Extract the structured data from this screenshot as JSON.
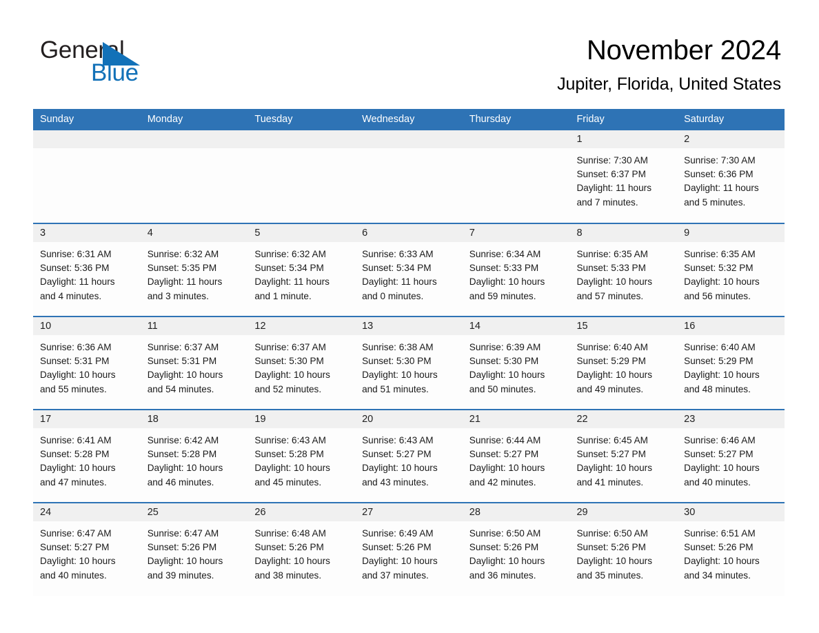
{
  "brand": {
    "name_part1": "General",
    "name_part2": "Blue",
    "logo_icon": "triangle-logo-icon",
    "accent_color": "#1271b8"
  },
  "header": {
    "month_title": "November 2024",
    "location": "Jupiter, Florida, United States"
  },
  "theme": {
    "header_blue": "#2e73b5",
    "daynum_band_gray": "#f0f0f0",
    "cell_background": "#fdfdfd",
    "text_color": "#1a1a1a"
  },
  "weekday_headers": [
    "Sunday",
    "Monday",
    "Tuesday",
    "Wednesday",
    "Thursday",
    "Friday",
    "Saturday"
  ],
  "weeks": [
    [
      {
        "day": "",
        "sunrise": "",
        "sunset": "",
        "daylight_line1": "",
        "daylight_line2": "",
        "empty": true
      },
      {
        "day": "",
        "sunrise": "",
        "sunset": "",
        "daylight_line1": "",
        "daylight_line2": "",
        "empty": true
      },
      {
        "day": "",
        "sunrise": "",
        "sunset": "",
        "daylight_line1": "",
        "daylight_line2": "",
        "empty": true
      },
      {
        "day": "",
        "sunrise": "",
        "sunset": "",
        "daylight_line1": "",
        "daylight_line2": "",
        "empty": true
      },
      {
        "day": "",
        "sunrise": "",
        "sunset": "",
        "daylight_line1": "",
        "daylight_line2": "",
        "empty": true
      },
      {
        "day": "1",
        "sunrise": "Sunrise: 7:30 AM",
        "sunset": "Sunset: 6:37 PM",
        "daylight_line1": "Daylight: 11 hours",
        "daylight_line2": "and 7 minutes."
      },
      {
        "day": "2",
        "sunrise": "Sunrise: 7:30 AM",
        "sunset": "Sunset: 6:36 PM",
        "daylight_line1": "Daylight: 11 hours",
        "daylight_line2": "and 5 minutes."
      }
    ],
    [
      {
        "day": "3",
        "sunrise": "Sunrise: 6:31 AM",
        "sunset": "Sunset: 5:36 PM",
        "daylight_line1": "Daylight: 11 hours",
        "daylight_line2": "and 4 minutes."
      },
      {
        "day": "4",
        "sunrise": "Sunrise: 6:32 AM",
        "sunset": "Sunset: 5:35 PM",
        "daylight_line1": "Daylight: 11 hours",
        "daylight_line2": "and 3 minutes."
      },
      {
        "day": "5",
        "sunrise": "Sunrise: 6:32 AM",
        "sunset": "Sunset: 5:34 PM",
        "daylight_line1": "Daylight: 11 hours",
        "daylight_line2": "and 1 minute."
      },
      {
        "day": "6",
        "sunrise": "Sunrise: 6:33 AM",
        "sunset": "Sunset: 5:34 PM",
        "daylight_line1": "Daylight: 11 hours",
        "daylight_line2": "and 0 minutes."
      },
      {
        "day": "7",
        "sunrise": "Sunrise: 6:34 AM",
        "sunset": "Sunset: 5:33 PM",
        "daylight_line1": "Daylight: 10 hours",
        "daylight_line2": "and 59 minutes."
      },
      {
        "day": "8",
        "sunrise": "Sunrise: 6:35 AM",
        "sunset": "Sunset: 5:33 PM",
        "daylight_line1": "Daylight: 10 hours",
        "daylight_line2": "and 57 minutes."
      },
      {
        "day": "9",
        "sunrise": "Sunrise: 6:35 AM",
        "sunset": "Sunset: 5:32 PM",
        "daylight_line1": "Daylight: 10 hours",
        "daylight_line2": "and 56 minutes."
      }
    ],
    [
      {
        "day": "10",
        "sunrise": "Sunrise: 6:36 AM",
        "sunset": "Sunset: 5:31 PM",
        "daylight_line1": "Daylight: 10 hours",
        "daylight_line2": "and 55 minutes."
      },
      {
        "day": "11",
        "sunrise": "Sunrise: 6:37 AM",
        "sunset": "Sunset: 5:31 PM",
        "daylight_line1": "Daylight: 10 hours",
        "daylight_line2": "and 54 minutes."
      },
      {
        "day": "12",
        "sunrise": "Sunrise: 6:37 AM",
        "sunset": "Sunset: 5:30 PM",
        "daylight_line1": "Daylight: 10 hours",
        "daylight_line2": "and 52 minutes."
      },
      {
        "day": "13",
        "sunrise": "Sunrise: 6:38 AM",
        "sunset": "Sunset: 5:30 PM",
        "daylight_line1": "Daylight: 10 hours",
        "daylight_line2": "and 51 minutes."
      },
      {
        "day": "14",
        "sunrise": "Sunrise: 6:39 AM",
        "sunset": "Sunset: 5:30 PM",
        "daylight_line1": "Daylight: 10 hours",
        "daylight_line2": "and 50 minutes."
      },
      {
        "day": "15",
        "sunrise": "Sunrise: 6:40 AM",
        "sunset": "Sunset: 5:29 PM",
        "daylight_line1": "Daylight: 10 hours",
        "daylight_line2": "and 49 minutes."
      },
      {
        "day": "16",
        "sunrise": "Sunrise: 6:40 AM",
        "sunset": "Sunset: 5:29 PM",
        "daylight_line1": "Daylight: 10 hours",
        "daylight_line2": "and 48 minutes."
      }
    ],
    [
      {
        "day": "17",
        "sunrise": "Sunrise: 6:41 AM",
        "sunset": "Sunset: 5:28 PM",
        "daylight_line1": "Daylight: 10 hours",
        "daylight_line2": "and 47 minutes."
      },
      {
        "day": "18",
        "sunrise": "Sunrise: 6:42 AM",
        "sunset": "Sunset: 5:28 PM",
        "daylight_line1": "Daylight: 10 hours",
        "daylight_line2": "and 46 minutes."
      },
      {
        "day": "19",
        "sunrise": "Sunrise: 6:43 AM",
        "sunset": "Sunset: 5:28 PM",
        "daylight_line1": "Daylight: 10 hours",
        "daylight_line2": "and 45 minutes."
      },
      {
        "day": "20",
        "sunrise": "Sunrise: 6:43 AM",
        "sunset": "Sunset: 5:27 PM",
        "daylight_line1": "Daylight: 10 hours",
        "daylight_line2": "and 43 minutes."
      },
      {
        "day": "21",
        "sunrise": "Sunrise: 6:44 AM",
        "sunset": "Sunset: 5:27 PM",
        "daylight_line1": "Daylight: 10 hours",
        "daylight_line2": "and 42 minutes."
      },
      {
        "day": "22",
        "sunrise": "Sunrise: 6:45 AM",
        "sunset": "Sunset: 5:27 PM",
        "daylight_line1": "Daylight: 10 hours",
        "daylight_line2": "and 41 minutes."
      },
      {
        "day": "23",
        "sunrise": "Sunrise: 6:46 AM",
        "sunset": "Sunset: 5:27 PM",
        "daylight_line1": "Daylight: 10 hours",
        "daylight_line2": "and 40 minutes."
      }
    ],
    [
      {
        "day": "24",
        "sunrise": "Sunrise: 6:47 AM",
        "sunset": "Sunset: 5:27 PM",
        "daylight_line1": "Daylight: 10 hours",
        "daylight_line2": "and 40 minutes."
      },
      {
        "day": "25",
        "sunrise": "Sunrise: 6:47 AM",
        "sunset": "Sunset: 5:26 PM",
        "daylight_line1": "Daylight: 10 hours",
        "daylight_line2": "and 39 minutes."
      },
      {
        "day": "26",
        "sunrise": "Sunrise: 6:48 AM",
        "sunset": "Sunset: 5:26 PM",
        "daylight_line1": "Daylight: 10 hours",
        "daylight_line2": "and 38 minutes."
      },
      {
        "day": "27",
        "sunrise": "Sunrise: 6:49 AM",
        "sunset": "Sunset: 5:26 PM",
        "daylight_line1": "Daylight: 10 hours",
        "daylight_line2": "and 37 minutes."
      },
      {
        "day": "28",
        "sunrise": "Sunrise: 6:50 AM",
        "sunset": "Sunset: 5:26 PM",
        "daylight_line1": "Daylight: 10 hours",
        "daylight_line2": "and 36 minutes."
      },
      {
        "day": "29",
        "sunrise": "Sunrise: 6:50 AM",
        "sunset": "Sunset: 5:26 PM",
        "daylight_line1": "Daylight: 10 hours",
        "daylight_line2": "and 35 minutes."
      },
      {
        "day": "30",
        "sunrise": "Sunrise: 6:51 AM",
        "sunset": "Sunset: 5:26 PM",
        "daylight_line1": "Daylight: 10 hours",
        "daylight_line2": "and 34 minutes."
      }
    ]
  ]
}
